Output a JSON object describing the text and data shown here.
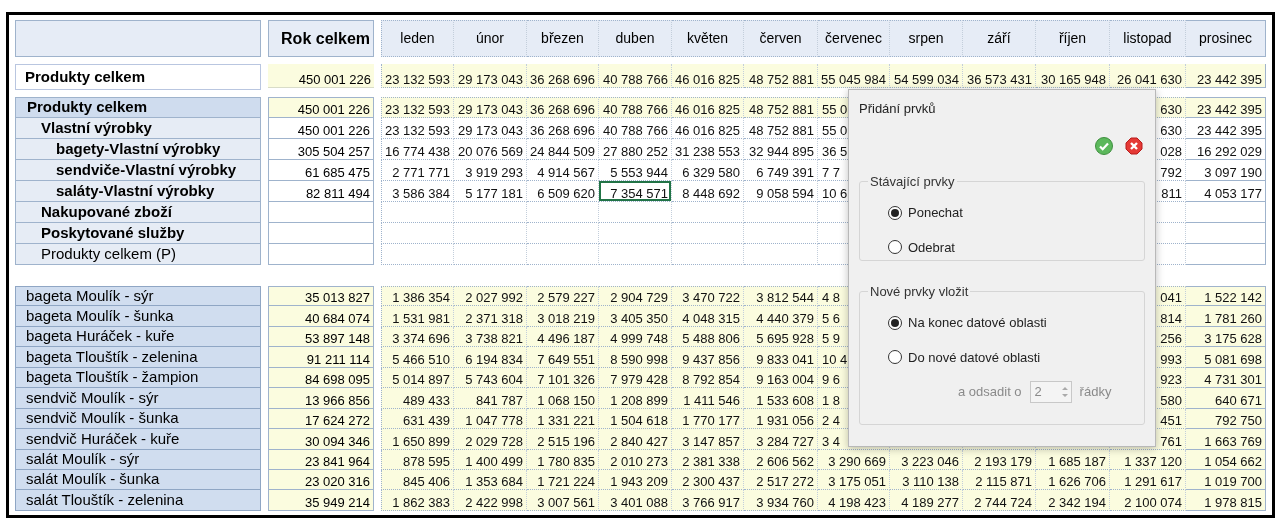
{
  "header": {
    "total": "Rok celkem",
    "months": [
      "leden",
      "únor",
      "březen",
      "duben",
      "květen",
      "červen",
      "červenec",
      "srpen",
      "září",
      "říjen",
      "listopad",
      "prosinec"
    ]
  },
  "summary": {
    "label": "Produkty celkem",
    "total": "450 001 226",
    "months": [
      "23 132 593",
      "29 173 043",
      "36 268 696",
      "40 788 766",
      "46 016 825",
      "48 752 881",
      "55 045 984",
      "54 599 034",
      "36 573 431",
      "30 165 948",
      "26 041 630",
      "23 442 395"
    ]
  },
  "tree": [
    {
      "label": "Produkty celkem",
      "kind": "group",
      "total": "450 001 226",
      "covered": true,
      "months": {
        "m01": {
          "v": "23 132 593",
          "selected": false
        },
        "m02": {
          "v": "29 173 043",
          "selected": false
        },
        "m03": {
          "v": "36 268 696",
          "selected": false
        },
        "m04": {
          "v": "40 788 766",
          "selected": false
        },
        "m05": {
          "v": "46 016 825",
          "selected": false
        },
        "m06": {
          "v": "48 752 881",
          "selected": false
        },
        "m07": {
          "v": "55 0",
          "selected": false
        },
        "m11": {
          "v": "630",
          "selected": false
        },
        "m12": {
          "v": "23 442 395",
          "selected": false
        }
      },
      "children": [
        {
          "label": "Vlastní výrobky",
          "kind": "group",
          "total": "450 001 226",
          "covered": true,
          "months": {
            "m01": {
              "v": "23 132 593",
              "selected": false
            },
            "m02": {
              "v": "29 173 043",
              "selected": false
            },
            "m03": {
              "v": "36 268 696",
              "selected": false
            },
            "m04": {
              "v": "40 788 766",
              "selected": false
            },
            "m05": {
              "v": "46 016 825",
              "selected": false
            },
            "m06": {
              "v": "48 752 881",
              "selected": false
            },
            "m07": {
              "v": "55 0",
              "selected": false
            },
            "m11": {
              "v": "630",
              "selected": false
            },
            "m12": {
              "v": "23 442 395",
              "selected": false
            }
          },
          "children": [
            {
              "label": "bagety-Vlastní výrobky",
              "kind": "group",
              "total": "305 504 257",
              "covered": true,
              "months": {
                "m01": {
                  "v": "16 774 438",
                  "selected": false
                },
                "m02": {
                  "v": "20 076 569",
                  "selected": false
                },
                "m03": {
                  "v": "24 844 509",
                  "selected": false
                },
                "m04": {
                  "v": "27 880 252",
                  "selected": false
                },
                "m05": {
                  "v": "31 238 553",
                  "selected": false
                },
                "m06": {
                  "v": "32 944 895",
                  "selected": false
                },
                "m07": {
                  "v": "36 5",
                  "selected": false
                },
                "m11": {
                  "v": "028",
                  "selected": false
                },
                "m12": {
                  "v": "16 292 029",
                  "selected": false
                }
              }
            },
            {
              "label": "sendviče-Vlastní výrobky",
              "kind": "group",
              "total": "61 685 475",
              "covered": true,
              "months": {
                "m01": {
                  "v": "2 771 771",
                  "selected": false
                },
                "m02": {
                  "v": "3 919 293",
                  "selected": false
                },
                "m03": {
                  "v": "4 914 567",
                  "selected": false
                },
                "m04": {
                  "v": "5 553 944",
                  "selected": false
                },
                "m05": {
                  "v": "6 329 580",
                  "selected": false
                },
                "m06": {
                  "v": "6 749 391",
                  "selected": false
                },
                "m07": {
                  "v": "7 7",
                  "selected": false
                },
                "m11": {
                  "v": "792",
                  "selected": false
                },
                "m12": {
                  "v": "3 097 190",
                  "selected": false
                }
              }
            },
            {
              "label": "saláty-Vlastní výrobky",
              "kind": "group",
              "total": "82 811 494",
              "covered": true,
              "months": {
                "m01": {
                  "v": "3 586 384",
                  "selected": false
                },
                "m02": {
                  "v": "5 177 181",
                  "selected": false
                },
                "m03": {
                  "v": "6 509 620",
                  "selected": false
                },
                "m04": {
                  "v": "7 354 571",
                  "selected": true
                },
                "m05": {
                  "v": "8 448 692",
                  "selected": false
                },
                "m06": {
                  "v": "9 058 594",
                  "selected": false
                },
                "m07": {
                  "v": "10 6",
                  "selected": false
                },
                "m11": {
                  "v": "811",
                  "selected": false
                },
                "m12": {
                  "v": "4 053 177",
                  "selected": false
                }
              }
            }
          ]
        },
        {
          "label": "Nakupované zboží",
          "kind": "group"
        },
        {
          "label": "Poskytované služby",
          "kind": "group"
        },
        {
          "label": "Produkty celkem (P)",
          "kind": "formula"
        }
      ]
    }
  ],
  "products": [
    {
      "label": "bageta Moulík - sýr",
      "total": "35 013 827",
      "covered": true,
      "months": {
        "m01": "1 386 354",
        "m02": "2 027 992",
        "m03": "2 579 227",
        "m04": "2 904 729",
        "m05": "3 470 722",
        "m06": "3 812 544",
        "m07": "4 8",
        "m11": "041",
        "m12": "1 522 142"
      }
    },
    {
      "label": "bageta Moulík - šunka",
      "total": "40 684 074",
      "covered": true,
      "months": {
        "m01": "1 531 981",
        "m02": "2 371 318",
        "m03": "3 018 219",
        "m04": "3 405 350",
        "m05": "4 048 315",
        "m06": "4 440 379",
        "m07": "5 6",
        "m11": "814",
        "m12": "1 781 260"
      }
    },
    {
      "label": "bageta Huráček - kuře",
      "total": "53 897 148",
      "covered": true,
      "months": {
        "m01": "3 374 696",
        "m02": "3 738 821",
        "m03": "4 496 187",
        "m04": "4 999 748",
        "m05": "5 488 806",
        "m06": "5 695 928",
        "m07": "5 9",
        "m11": "256",
        "m12": "3 175 628"
      }
    },
    {
      "label": "bageta Tlouštík - zelenina",
      "total": "91 211 114",
      "covered": true,
      "months": {
        "m01": "5 466 510",
        "m02": "6 194 834",
        "m03": "7 649 551",
        "m04": "8 590 998",
        "m05": "9 437 856",
        "m06": "9 833 041",
        "m07": "10 4",
        "m11": "993",
        "m12": "5 081 698"
      }
    },
    {
      "label": "bageta Tlouštík - žampion",
      "total": "84 698 095",
      "covered": true,
      "months": {
        "m01": "5 014 897",
        "m02": "5 743 604",
        "m03": "7 101 326",
        "m04": "7 979 428",
        "m05": "8 792 854",
        "m06": "9 163 004",
        "m07": "9 6",
        "m11": "923",
        "m12": "4 731 301"
      }
    },
    {
      "label": "sendvič Moulík - sýr",
      "total": "13 966 856",
      "covered": true,
      "months": {
        "m01": "489 433",
        "m02": "841 787",
        "m03": "1 068 150",
        "m04": "1 208 899",
        "m05": "1 411 546",
        "m06": "1 533 608",
        "m07": "1 8",
        "m11": "580",
        "m12": "640 671"
      }
    },
    {
      "label": "sendvič Moulík - šunka",
      "total": "17 624 272",
      "covered": true,
      "months": {
        "m01": "631 439",
        "m02": "1 047 778",
        "m03": "1 331 221",
        "m04": "1 504 618",
        "m05": "1 770 177",
        "m06": "1 931 056",
        "m07": "2 4",
        "m11": "451",
        "m12": "792 750"
      }
    },
    {
      "label": "sendvič Huráček - kuře",
      "total": "30 094 346",
      "covered": true,
      "months": {
        "m01": "1 650 899",
        "m02": "2 029 728",
        "m03": "2 515 196",
        "m04": "2 840 427",
        "m05": "3 147 857",
        "m06": "3 284 727",
        "m07": "3 4",
        "m11": "761",
        "m12": "1 663 769"
      }
    },
    {
      "label": "salát Moulík - sýr",
      "total": "23 841 964",
      "covered": false,
      "months": {
        "m01": "878 595",
        "m02": "1 400 499",
        "m03": "1 780 835",
        "m04": "2 010 273",
        "m05": "2 381 338",
        "m06": "2 606 562",
        "m07": "3 290 669",
        "m08": "3 223 046",
        "m09": "2 193 179",
        "m10": "1 685 187",
        "m11": "1 337 120",
        "m12": "1 054 662"
      }
    },
    {
      "label": "salát Moulík - šunka",
      "total": "23 020 316",
      "covered": false,
      "months": {
        "m01": "845 406",
        "m02": "1 353 684",
        "m03": "1 721 224",
        "m04": "1 943 209",
        "m05": "2 300 437",
        "m06": "2 517 272",
        "m07": "3 175 051",
        "m08": "3 110 138",
        "m09": "2 115 871",
        "m10": "1 626 706",
        "m11": "1 291 617",
        "m12": "1 019 700"
      }
    },
    {
      "label": "salát Tlouštík - zelenina",
      "total": "35 949 214",
      "covered": false,
      "months": {
        "m01": "1 862 383",
        "m02": "2 422 998",
        "m03": "3 007 561",
        "m04": "3 401 088",
        "m05": "3 766 917",
        "m06": "3 934 760",
        "m07": "4 198 423",
        "m08": "4 189 277",
        "m09": "2 744 724",
        "m10": "2 342 194",
        "m11": "2 100 074",
        "m12": "1 978 815"
      }
    }
  ],
  "dialog": {
    "title": "Přidání prvků",
    "groups": [
      {
        "legend": "Stávající prvky",
        "options": [
          {
            "label": "Ponechat",
            "selected": true
          },
          {
            "label": "Odebrat",
            "selected": false
          }
        ]
      },
      {
        "legend": "Nové prvky vložit",
        "options": [
          {
            "label": "Na konec datové oblasti",
            "selected": true
          },
          {
            "label": "Do nové datové oblasti",
            "selected": false
          }
        ],
        "offset": {
          "prefix": "a odsadit o",
          "value": "2",
          "suffix": "řádky",
          "disabled": true
        }
      }
    ]
  }
}
